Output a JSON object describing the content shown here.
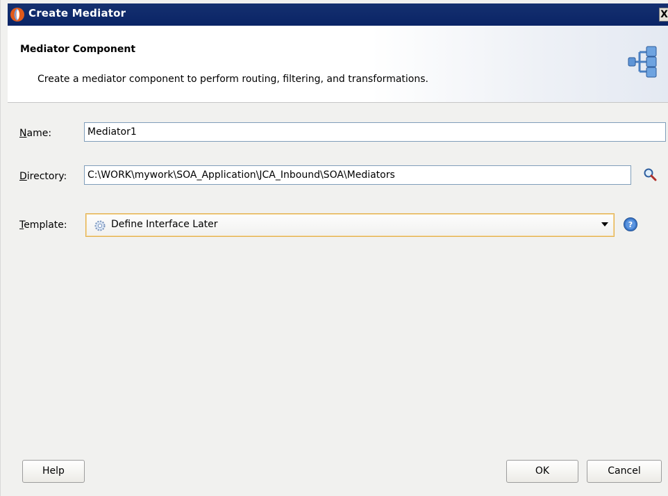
{
  "window": {
    "title": "Create Mediator",
    "close_label": "X"
  },
  "banner": {
    "heading": "Mediator Component",
    "description": "Create a mediator component to perform routing, filtering, and transformations.",
    "icon": "mediator-component-icon"
  },
  "form": {
    "name": {
      "label_mnemonic": "N",
      "label_rest": "ame:",
      "value": "Mediator1"
    },
    "directory": {
      "label_mnemonic": "D",
      "label_rest": "irectory:",
      "value": "C:\\WORK\\mywork\\SOA_Application\\JCA_Inbound\\SOA\\Mediators",
      "browse_icon": "search-icon"
    },
    "template": {
      "label_mnemonic": "T",
      "label_rest": "emplate:",
      "selected": "Define Interface Later",
      "help_icon": "help-icon"
    }
  },
  "buttons": {
    "help": "Help",
    "ok": "OK",
    "cancel": "Cancel"
  },
  "colors": {
    "title_bar": "#0a2466",
    "dialog_bg": "#f1f1ef",
    "select_focus_border": "#e3b24f"
  }
}
